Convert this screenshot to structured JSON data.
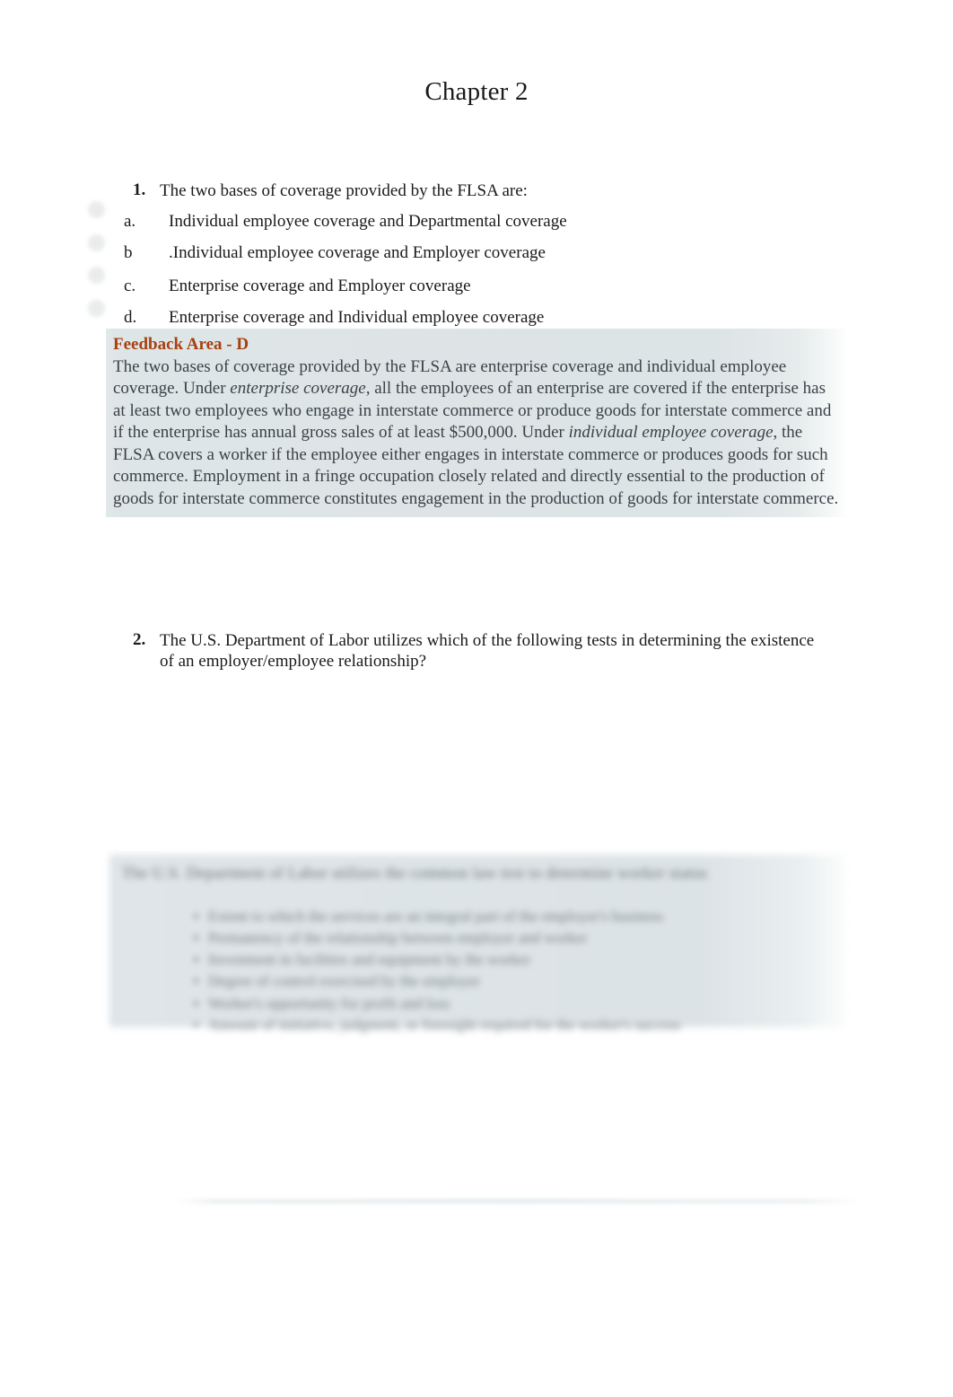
{
  "document": {
    "title": "Chapter 2",
    "page_background": "#ffffff",
    "text_color": "#1a1a1a"
  },
  "colors": {
    "feedback_heading": "#a8400f",
    "feedback_background": "#dee5e7",
    "feedback_body_text": "#3a4248",
    "redacted_background": "#dce3e6"
  },
  "questions": [
    {
      "number": "1.",
      "text": "The two bases of coverage provided by the FLSA are:",
      "options": [
        {
          "letter": "a.",
          "text": "Individual employee coverage and Departmental coverage"
        },
        {
          "letter": "b",
          "text": ".Individual employee coverage and Employer coverage"
        },
        {
          "letter": "c.",
          "text": "Enterprise coverage and Employer coverage"
        },
        {
          "letter": "d.",
          "text": "Enterprise coverage and Individual employee coverage"
        }
      ]
    },
    {
      "number": "2.",
      "text": "The U.S. Department of Labor utilizes which of the following tests in determining the existence of an employer/employee relationship?"
    }
  ],
  "feedback": {
    "heading": "Feedback Area - D",
    "sentence_1_part_1": "The two bases of coverage provided by the FLSA are enterprise coverage and individual employee coverage. Under ",
    "italic_1": "enterprise coverage",
    "sentence_1_part_2": ", all the employees of an enterprise are covered if the enterprise has at least two employees who engage in interstate commerce or produce goods for interstate commerce and if the enterprise has annual gross sales of at least $500,000. Under ",
    "italic_2": "individual employee coverage",
    "sentence_1_part_3": ", the FLSA covers a worker if the employee either engages in interstate commerce or produces goods for such commerce. Employment in a fringe occupation closely related and directly essential to the production of goods for interstate commerce constitutes engagement in the production of goods for interstate commerce."
  },
  "redacted_block": {
    "note": "blurred-illegible-content",
    "title_placeholder": "The U.S. Department of Labor utilizes the common law test to determine worker status",
    "items": [
      "Extent to which the services are an integral part of the employer's business",
      "Permanency of the relationship between employer and worker",
      "Investment in facilities and equipment by the worker",
      "Degree of control exercised by the employer",
      "Worker's opportunity for profit and loss",
      "Amount of initiative, judgment, or foresight required for the worker's success"
    ]
  },
  "margin_marks": {
    "count": 4,
    "note": "faint circular margin indicators"
  }
}
